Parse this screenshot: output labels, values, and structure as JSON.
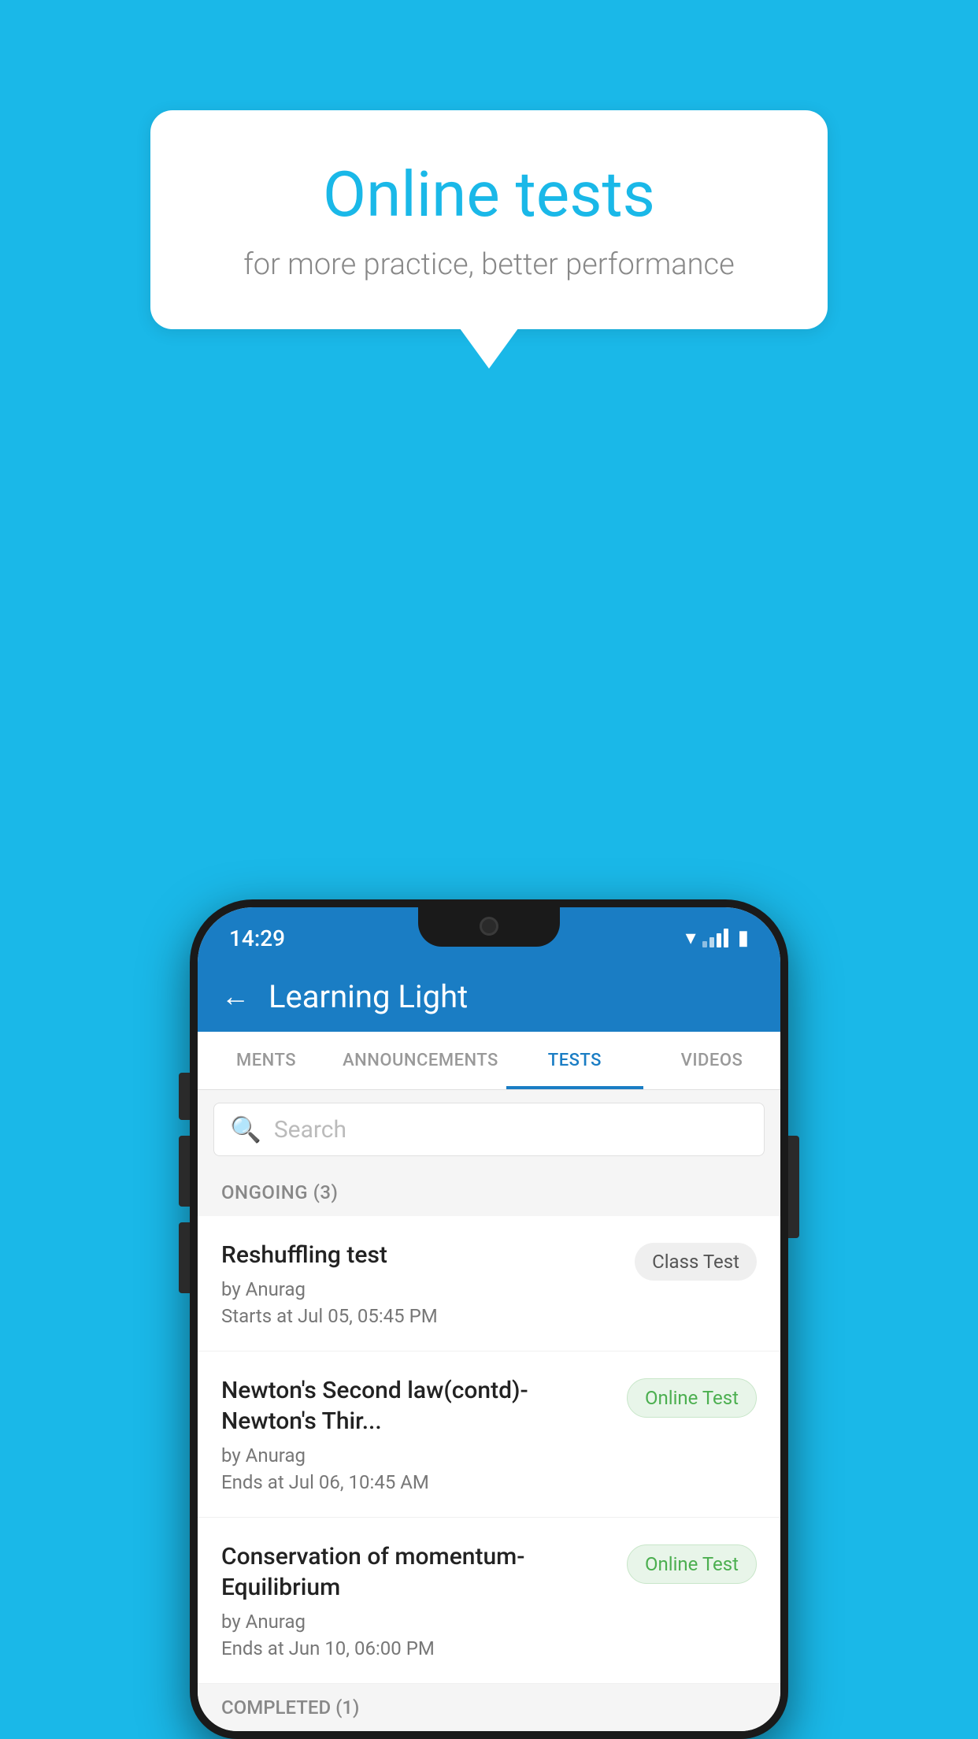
{
  "background_color": "#1ab8e8",
  "speech_bubble": {
    "title": "Online tests",
    "subtitle": "for more practice, better performance"
  },
  "phone": {
    "status_bar": {
      "time": "14:29",
      "icons": [
        "wifi",
        "signal",
        "battery"
      ]
    },
    "app_header": {
      "title": "Learning Light",
      "back_label": "←"
    },
    "tabs": [
      {
        "label": "MENTS",
        "active": false
      },
      {
        "label": "ANNOUNCEMENTS",
        "active": false
      },
      {
        "label": "TESTS",
        "active": true
      },
      {
        "label": "VIDEOS",
        "active": false
      }
    ],
    "search": {
      "placeholder": "Search"
    },
    "sections": [
      {
        "header": "ONGOING (3)",
        "items": [
          {
            "name": "Reshuffling test",
            "author": "by Anurag",
            "time_label": "Starts at",
            "time": "Jul 05, 05:45 PM",
            "badge": "Class Test",
            "badge_type": "class"
          },
          {
            "name": "Newton's Second law(contd)-Newton's Thir...",
            "author": "by Anurag",
            "time_label": "Ends at",
            "time": "Jul 06, 10:45 AM",
            "badge": "Online Test",
            "badge_type": "online"
          },
          {
            "name": "Conservation of momentum-Equilibrium",
            "author": "by Anurag",
            "time_label": "Ends at",
            "time": "Jun 10, 06:00 PM",
            "badge": "Online Test",
            "badge_type": "online"
          }
        ]
      },
      {
        "header": "COMPLETED (1)",
        "items": []
      }
    ]
  }
}
